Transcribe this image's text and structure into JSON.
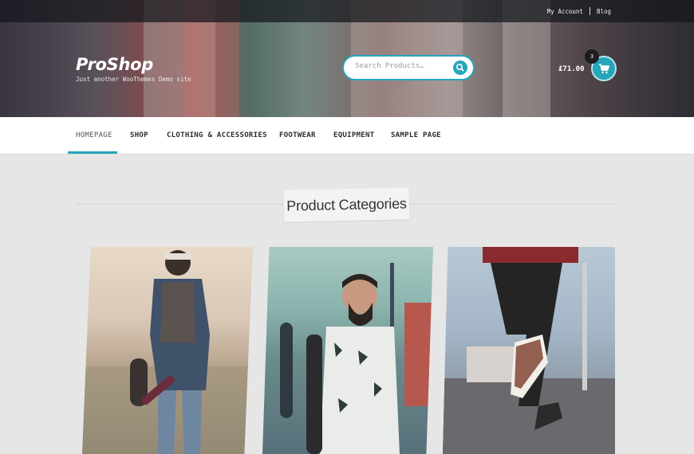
{
  "topbar": {
    "links": [
      "My Account",
      "Blog"
    ]
  },
  "brand": {
    "title": "ProShop",
    "tagline": "Just another WooThemes Demo site"
  },
  "search": {
    "placeholder": "Search Products…"
  },
  "cart": {
    "total": "£71.00",
    "count": "3"
  },
  "nav": {
    "items": [
      "HOMEPAGE",
      "SHOP",
      "CLOTHING & ACCESSORIES",
      "FOOTWEAR",
      "EQUIPMENT",
      "SAMPLE PAGE"
    ],
    "active": "HOMEPAGE"
  },
  "content": {
    "section_title": "Product Categories"
  },
  "colors": {
    "accent": "#27a5bb",
    "nav_bg": "#ffffff",
    "page_bg": "#e6e6e6"
  },
  "icons": [
    "search-icon",
    "cart-icon"
  ]
}
